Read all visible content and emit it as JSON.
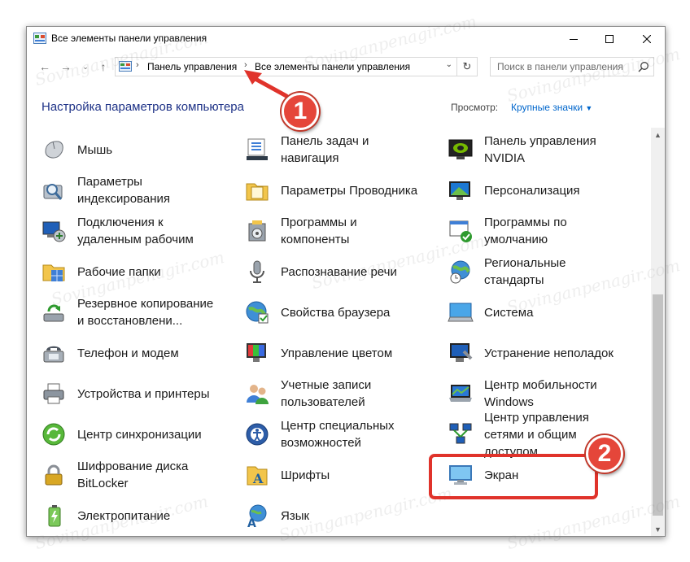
{
  "window": {
    "title": "Все элементы панели управления",
    "controls": {
      "minimize": "minimize-icon",
      "maximize": "maximize-icon",
      "close": "close-icon"
    }
  },
  "address": {
    "crumbs": [
      "Панель управления",
      "Все элементы панели управления"
    ],
    "search_placeholder": "Поиск в панели управления"
  },
  "header": {
    "title": "Настройка параметров компьютера",
    "view_label": "Просмотр:",
    "view_value": "Крупные значки"
  },
  "items": [
    {
      "label": "Мышь",
      "icon": "mouse-icon"
    },
    {
      "label": "Параметры индексирования",
      "icon": "indexing-icon"
    },
    {
      "label": "Подключения к удаленным рабочим",
      "icon": "remote-desktop-icon"
    },
    {
      "label": "Рабочие папки",
      "icon": "work-folders-icon"
    },
    {
      "label": "Резервное копирование и восстановлени...",
      "icon": "backup-icon"
    },
    {
      "label": "Телефон и модем",
      "icon": "phone-modem-icon"
    },
    {
      "label": "Устройства и принтеры",
      "icon": "printer-icon"
    },
    {
      "label": "Центр синхронизации",
      "icon": "sync-icon"
    },
    {
      "label": "Шифрование диска BitLocker",
      "icon": "bitlocker-icon"
    },
    {
      "label": "Электропитание",
      "icon": "battery-icon"
    },
    {
      "label": "Панель задач и навигация",
      "icon": "taskbar-icon"
    },
    {
      "label": "Параметры Проводника",
      "icon": "explorer-options-icon"
    },
    {
      "label": "Программы и компоненты",
      "icon": "programs-icon"
    },
    {
      "label": "Распознавание речи",
      "icon": "microphone-icon"
    },
    {
      "label": "Свойства браузера",
      "icon": "internet-options-icon"
    },
    {
      "label": "Управление цветом",
      "icon": "color-management-icon"
    },
    {
      "label": "Учетные записи пользователей",
      "icon": "user-accounts-icon"
    },
    {
      "label": "Центр специальных возможностей",
      "icon": "accessibility-icon"
    },
    {
      "label": "Шрифты",
      "icon": "fonts-icon"
    },
    {
      "label": "Язык",
      "icon": "language-icon"
    },
    {
      "label": "Панель управления NVIDIA",
      "icon": "nvidia-icon"
    },
    {
      "label": "Персонализация",
      "icon": "personalization-icon"
    },
    {
      "label": "Программы по умолчанию",
      "icon": "default-programs-icon"
    },
    {
      "label": "Региональные стандарты",
      "icon": "region-icon"
    },
    {
      "label": "Система",
      "icon": "system-icon"
    },
    {
      "label": "Устранение неполадок",
      "icon": "troubleshooting-icon"
    },
    {
      "label": "Центр мобильности Windows",
      "icon": "mobility-icon"
    },
    {
      "label": "Центр управления сетями и общим доступом",
      "icon": "network-icon"
    },
    {
      "label": "Экран",
      "icon": "display-icon"
    }
  ],
  "annotations": {
    "marker1": "1",
    "marker2": "2",
    "color": "#e0332b"
  },
  "watermark": "Sovinganpenagir.com"
}
